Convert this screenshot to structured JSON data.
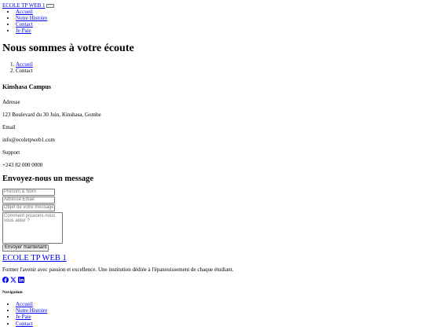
{
  "nav": {
    "brand": "ECOLE TP WEB 1",
    "items": [
      {
        "label": "Accueil"
      },
      {
        "label": "Notre Histoire"
      },
      {
        "label": "Contact"
      },
      {
        "label": "Je Paie"
      }
    ]
  },
  "page_title": "Nous sommes à votre écoute",
  "breadcrumb": {
    "home": "Accueil",
    "current": "Contact"
  },
  "campus": {
    "title": "Kinshasa Campus",
    "address_label": "Adresse",
    "address": "123 Boulevard du 30 Juin, Kinshasa, Gombe",
    "email_label": "Email",
    "email": "info@ecoletpweb1.com",
    "support_label": "Support",
    "support": "+243 82 000 0000"
  },
  "form": {
    "title": "Envoyez-nous un message",
    "name_placeholder": "Prénom & Nom",
    "email_placeholder": "Adresse Email",
    "subject_placeholder": "Objet de votre message",
    "message_placeholder": "Comment pouvons-nous vous aider ?",
    "submit_label": "Envoyer maintenant"
  },
  "footer": {
    "brand": "ECOLE TP WEB 1",
    "description": "Former l'avenir avec passion et excellence. Une institution dédiée à l'épanouissement de chaque étudiant.",
    "social_icons": [
      "facebook-icon",
      "x-icon",
      "linkedin-icon"
    ],
    "nav_title": "Navigation",
    "nav_items": [
      {
        "label": "Accueil"
      },
      {
        "label": "Notre Histoire"
      },
      {
        "label": "Je Paie"
      },
      {
        "label": "Contact"
      }
    ]
  },
  "colors": {
    "link": "#0000ee",
    "text": "#000000"
  }
}
